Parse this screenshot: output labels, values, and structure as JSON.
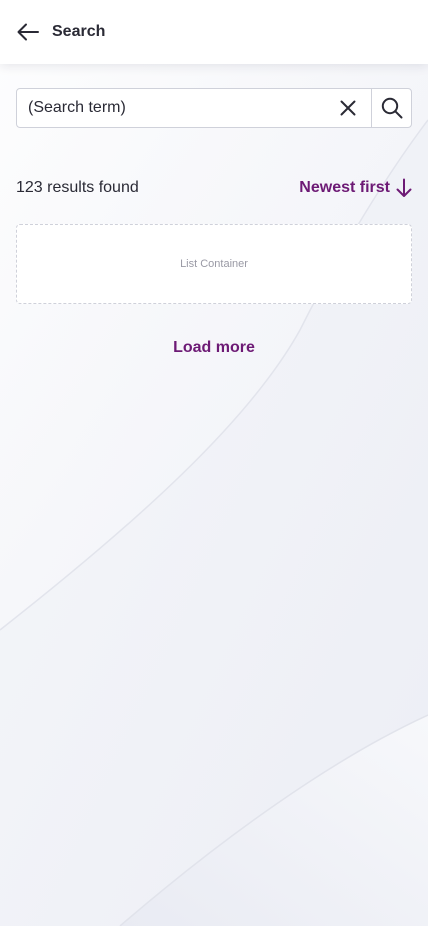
{
  "header": {
    "title": "Search",
    "back_icon": "arrow-left-icon"
  },
  "search": {
    "value": "(Search term)",
    "clear_icon": "close-icon",
    "submit_icon": "search-icon"
  },
  "results": {
    "count_text": "123 results found",
    "sort_label": "Newest first",
    "sort_icon": "arrow-down-icon"
  },
  "list": {
    "placeholder": "List Container"
  },
  "load_more": {
    "label": "Load more"
  },
  "colors": {
    "accent": "#6d1a75",
    "text": "#2a2a35",
    "border": "#cfd1da",
    "background": "#eef0f6"
  }
}
